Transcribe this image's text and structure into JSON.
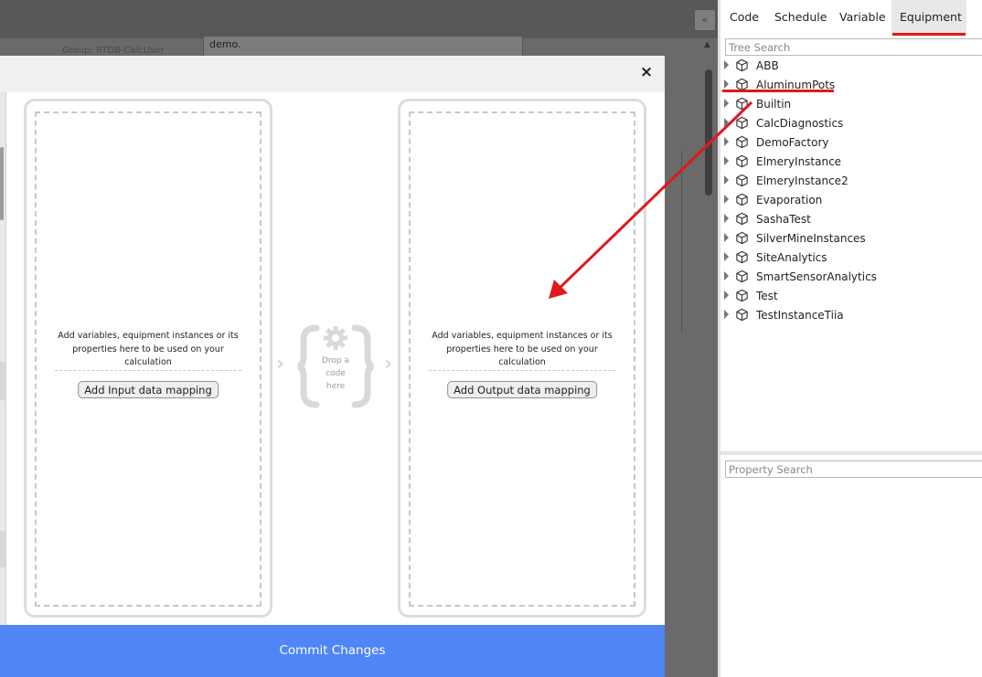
{
  "background": {
    "group_label": "Group: RTDB-CalcUser",
    "demo_text": "demo.",
    "collapse_icon": "«"
  },
  "modal": {
    "close_icon": "×",
    "input_panel": {
      "hint": "Add variables, equipment instances or its properties here to be used on your calculation",
      "button_label": "Add Input data mapping"
    },
    "code_drop": {
      "text_line1": "Drop a",
      "text_line2": "code",
      "text_line3": "here"
    },
    "output_panel": {
      "hint": "Add variables, equipment instances or its properties here to be used on your calculation",
      "button_label": "Add Output data mapping"
    },
    "commit_label": "Commit Changes"
  },
  "right_panel": {
    "tabs": [
      {
        "label": "Code"
      },
      {
        "label": "Schedule"
      },
      {
        "label": "Variable"
      },
      {
        "label": "Equipment"
      }
    ],
    "active_tab": "Equipment",
    "tree_search_placeholder": "Tree Search",
    "tree_items": [
      {
        "label": "ABB"
      },
      {
        "label": "AluminumPots"
      },
      {
        "label": "Builtin"
      },
      {
        "label": "CalcDiagnostics"
      },
      {
        "label": "DemoFactory"
      },
      {
        "label": "ElmeryInstance"
      },
      {
        "label": "ElmeryInstance2"
      },
      {
        "label": "Evaporation"
      },
      {
        "label": "SashaTest"
      },
      {
        "label": "SilverMineInstances"
      },
      {
        "label": "SiteAnalytics"
      },
      {
        "label": "SmartSensorAnalytics"
      },
      {
        "label": "Test"
      },
      {
        "label": "TestInstanceTiia"
      }
    ],
    "property_search_placeholder": "Property Search"
  },
  "annotation_color": "#e0191b",
  "accent_color": "#4f85f5"
}
